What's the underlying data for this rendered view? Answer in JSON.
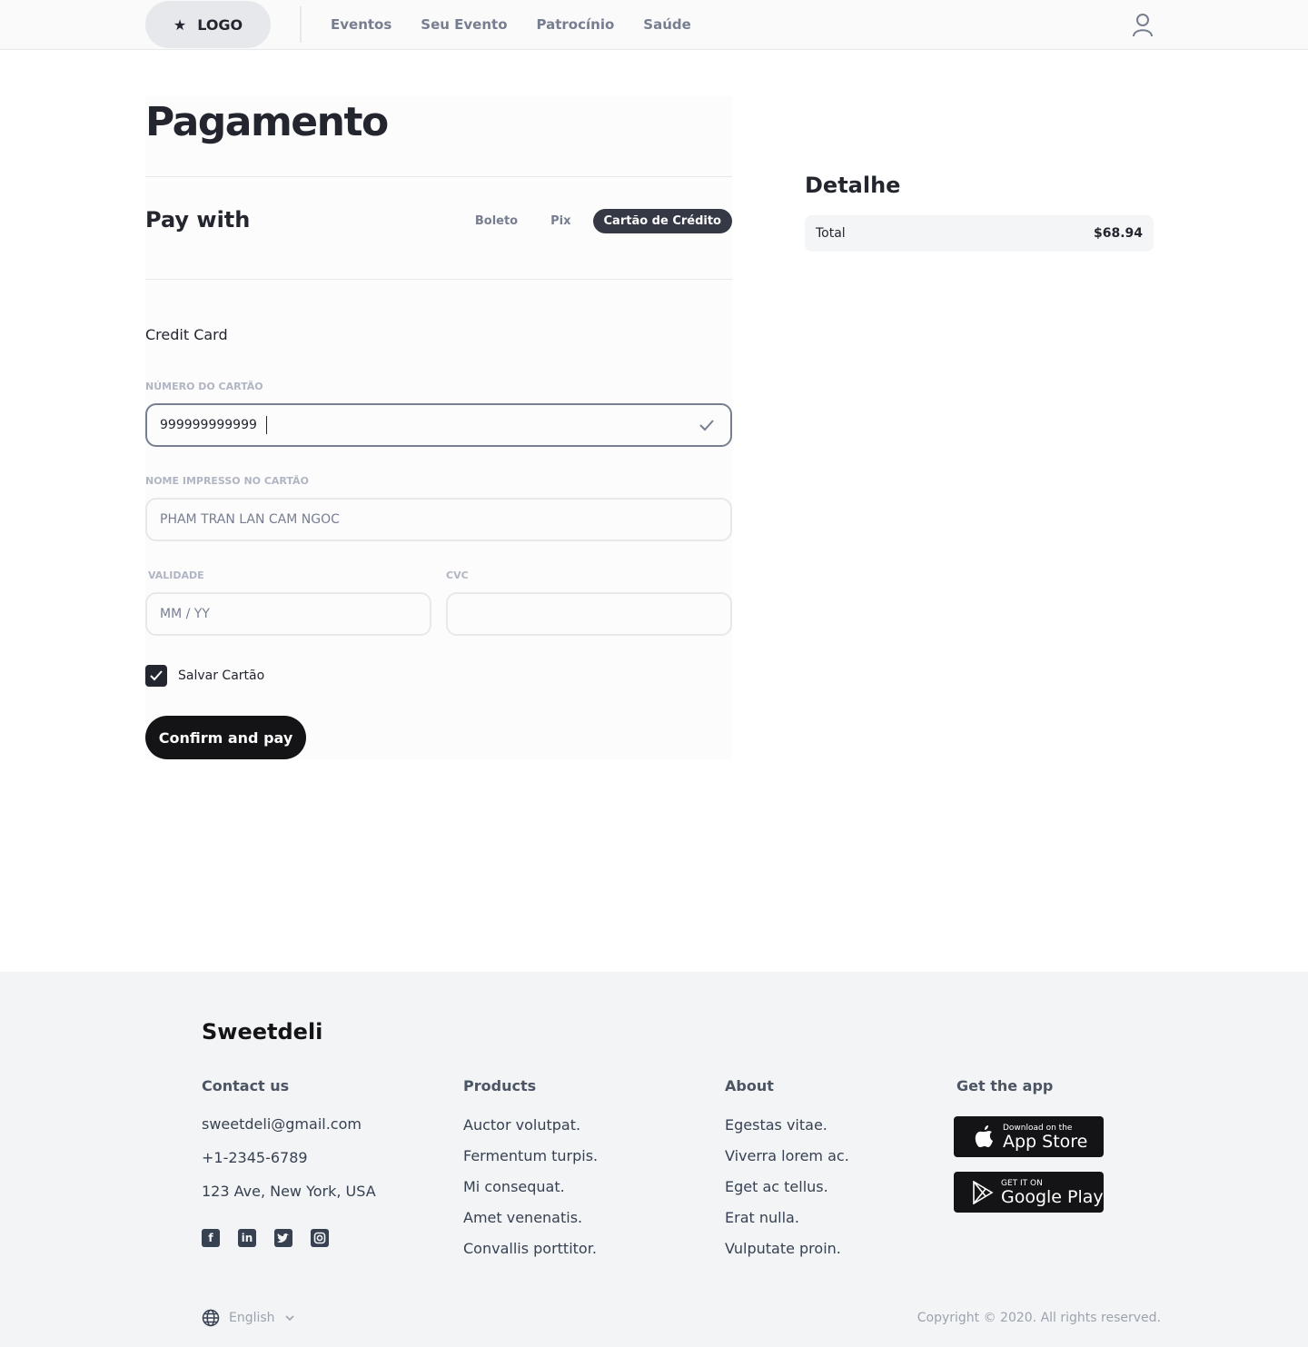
{
  "header": {
    "logo_label": "LOGO",
    "nav": [
      "Eventos",
      "Seu Evento",
      "Patrocínio",
      "Saúde"
    ]
  },
  "payment": {
    "title": "Pagamento",
    "pay_with": "Pay with",
    "methods": [
      "Boleto",
      "Pix",
      "Cartão de Crédito"
    ],
    "active_method": "Cartão de Crédito",
    "section_title": "Credit Card",
    "card_number_label": "Número do cartão",
    "card_number_value": "999999999999",
    "name_label": "Nome impresso no cartão",
    "name_placeholder": "PHAM TRAN LAN CAM NGOC",
    "expiry_label": "Validade",
    "expiry_placeholder": "MM / YY",
    "cvc_label": "CVC",
    "cvc_value": "",
    "save_card_label": "Salvar Cartão",
    "save_card_checked": true,
    "confirm_label": "Confirm and pay"
  },
  "detail": {
    "title": "Detalhe",
    "total_label": "Total",
    "total_value": "$68.94"
  },
  "footer": {
    "brand": "Sweetdeli",
    "contact": {
      "heading": "Contact us",
      "email": "sweetdeli@gmail.com",
      "phone": "+1-2345-6789",
      "address": "123 Ave, New York, USA"
    },
    "products": {
      "heading": "Products",
      "items": [
        "Auctor volutpat.",
        "Fermentum turpis.",
        "Mi consequat.",
        "Amet venenatis.",
        "Convallis porttitor."
      ]
    },
    "about": {
      "heading": "About",
      "items": [
        "Egestas vitae.",
        "Viverra lorem ac.",
        "Eget ac tellus.",
        "Erat nulla.",
        "Vulputate proin."
      ]
    },
    "app": {
      "heading": "Get the app",
      "appstore_small": "Download on the",
      "appstore_big": "App Store",
      "googleplay_small": "GET IT ON",
      "googleplay_big": "Google Play"
    },
    "language": "English",
    "copyright": "Copyright © 2020. All rights reserved."
  }
}
